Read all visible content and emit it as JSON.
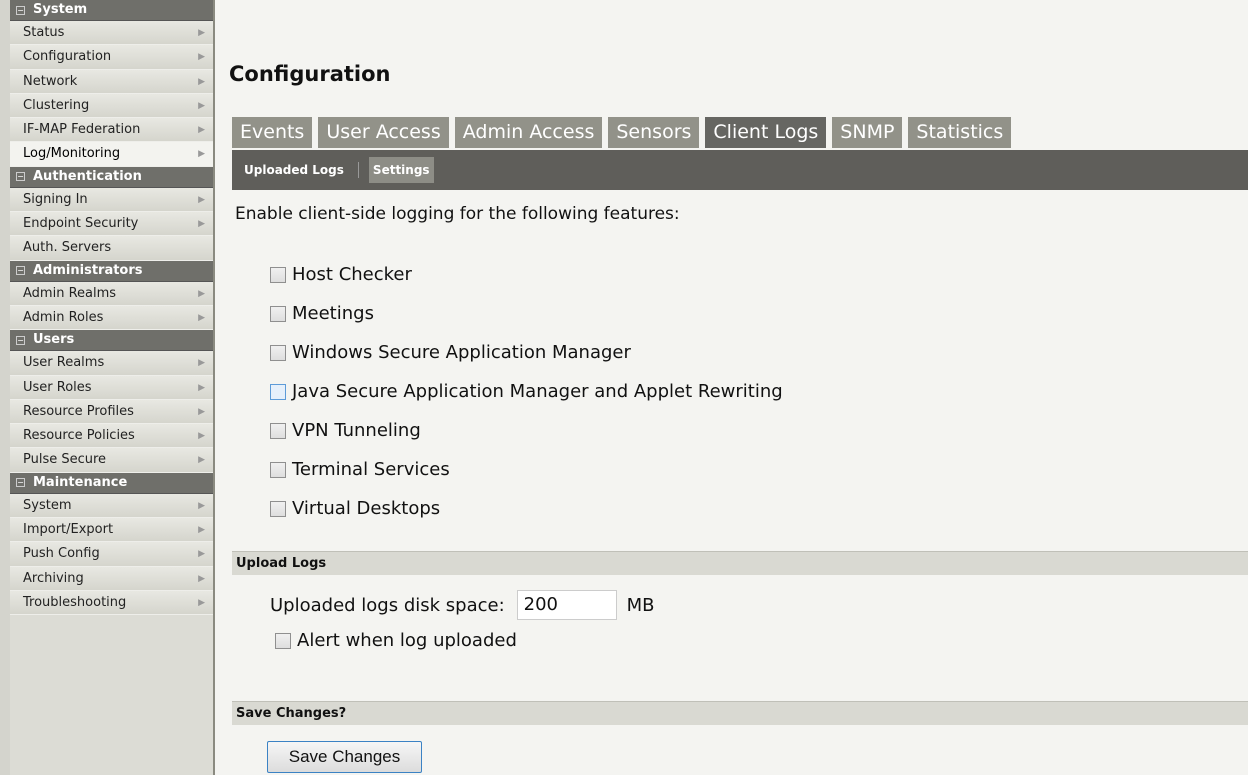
{
  "sidebar": {
    "groups": [
      {
        "title": "System",
        "items": [
          "Status",
          "Configuration",
          "Network",
          "Clustering",
          "IF-MAP Federation",
          "Log/Monitoring"
        ]
      },
      {
        "title": "Authentication",
        "items": [
          "Signing In",
          "Endpoint Security",
          "Auth. Servers"
        ]
      },
      {
        "title": "Administrators",
        "items": [
          "Admin Realms",
          "Admin Roles"
        ]
      },
      {
        "title": "Users",
        "items": [
          "User Realms",
          "User Roles",
          "Resource Profiles",
          "Resource Policies",
          "Pulse Secure"
        ]
      },
      {
        "title": "Maintenance",
        "items": [
          "System",
          "Import/Export",
          "Push Config",
          "Archiving",
          "Troubleshooting"
        ]
      }
    ]
  },
  "page": {
    "title": "Configuration"
  },
  "tabs": [
    "Events",
    "User Access",
    "Admin Access",
    "Sensors",
    "Client Logs",
    "SNMP",
    "Statistics"
  ],
  "subtabs": [
    "Uploaded Logs",
    "Settings"
  ],
  "content": {
    "intro": "Enable client-side logging for the following features:",
    "features": [
      "Host Checker",
      "Meetings",
      "Windows Secure Application Manager",
      "Java Secure Application Manager and Applet Rewriting",
      "VPN Tunneling",
      "Terminal Services",
      "Virtual Desktops"
    ],
    "upload_section_title": "Upload Logs",
    "disk_space_label": "Uploaded logs disk space:",
    "disk_space_value": "200",
    "disk_space_unit": "MB",
    "alert_label": "Alert when log uploaded",
    "save_section_title": "Save Changes?",
    "save_button": "Save Changes"
  }
}
